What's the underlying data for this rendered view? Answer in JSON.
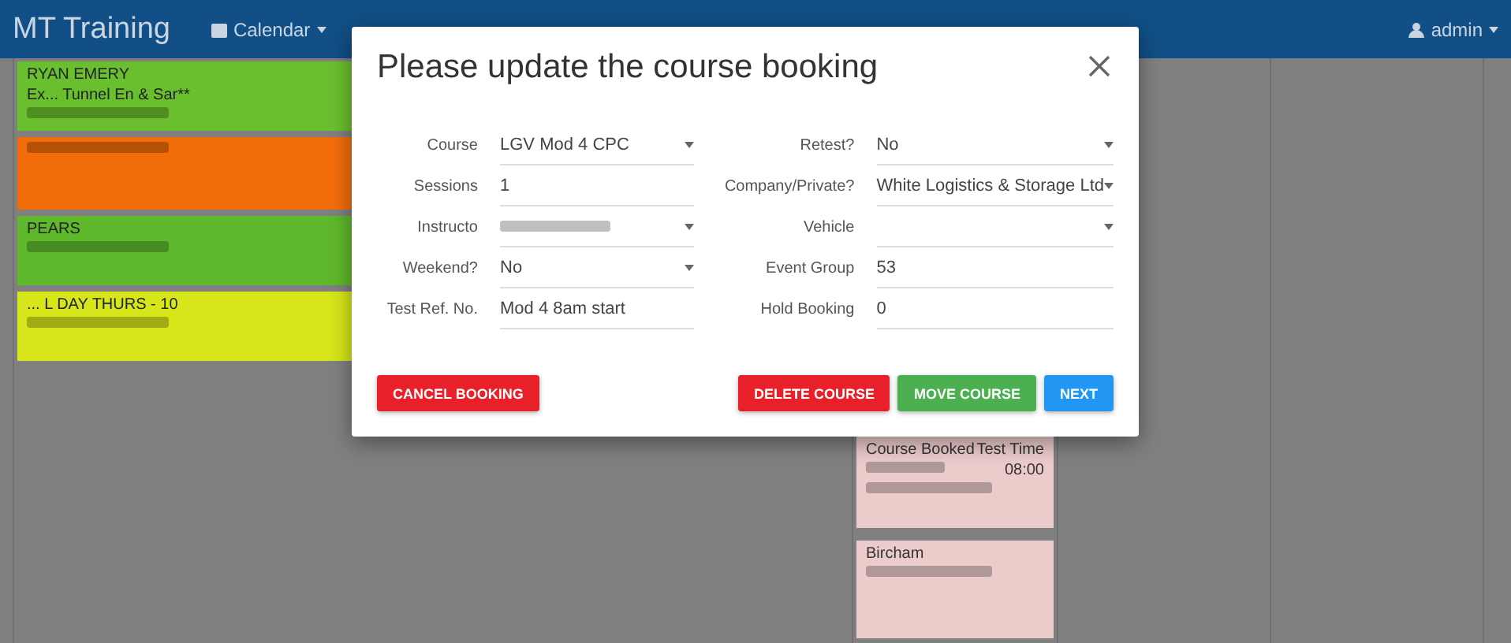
{
  "navbar": {
    "brand": "MT Training",
    "items": [
      {
        "label": "Calendar",
        "dropdown": true
      }
    ],
    "user": "admin"
  },
  "calendar": {
    "left_events": [
      {
        "color": "#6abf2e",
        "lines": [
          "RYAN EMERY",
          "Ex... Tunnel En & Sar**"
        ]
      },
      {
        "color": "#f26d0a"
      },
      {
        "color": "#5fb82c",
        "lines": [
          "PEARS"
        ]
      },
      {
        "color": "#d6e61a",
        "lines": [
          "... L DAY THURS - 10"
        ]
      }
    ],
    "right_events": [
      {
        "color": "#eccbcb",
        "rows": [
          {
            "left": "Course Booked",
            "right": "Test Time"
          },
          {
            "right": "08:00"
          }
        ]
      },
      {
        "color": "#eccbcb",
        "rows": [
          {
            "left": "Bircham"
          }
        ]
      }
    ]
  },
  "dialog": {
    "title": "Please update the course booking",
    "left_fields": [
      {
        "label": "Course",
        "value": "LGV Mod 4 CPC",
        "kind": "select"
      },
      {
        "label": "Sessions",
        "value": "1",
        "kind": "text"
      },
      {
        "label": "Instructo",
        "kind": "select",
        "redacted": true
      },
      {
        "label": "Weekend?",
        "value": "No",
        "kind": "select"
      },
      {
        "label": "Test Ref. No.",
        "value": "Mod 4 8am start",
        "kind": "text"
      }
    ],
    "right_fields": [
      {
        "label": "Retest?",
        "value": "No",
        "kind": "select"
      },
      {
        "label": "Company/Private?",
        "value": "White Logistics & Storage Ltd",
        "kind": "select"
      },
      {
        "label": "Vehicle",
        "kind": "select"
      },
      {
        "label": "Event Group",
        "value": "53",
        "kind": "text"
      },
      {
        "label": "Hold Booking",
        "value": "0",
        "kind": "text"
      }
    ],
    "buttons": [
      {
        "label": "CANCEL BOOKING",
        "kind": "danger"
      },
      {
        "label": "DELETE COURSE",
        "kind": "danger"
      },
      {
        "label": "MOVE COURSE",
        "kind": "success"
      },
      {
        "label": "NEXT",
        "kind": "primary"
      }
    ]
  }
}
